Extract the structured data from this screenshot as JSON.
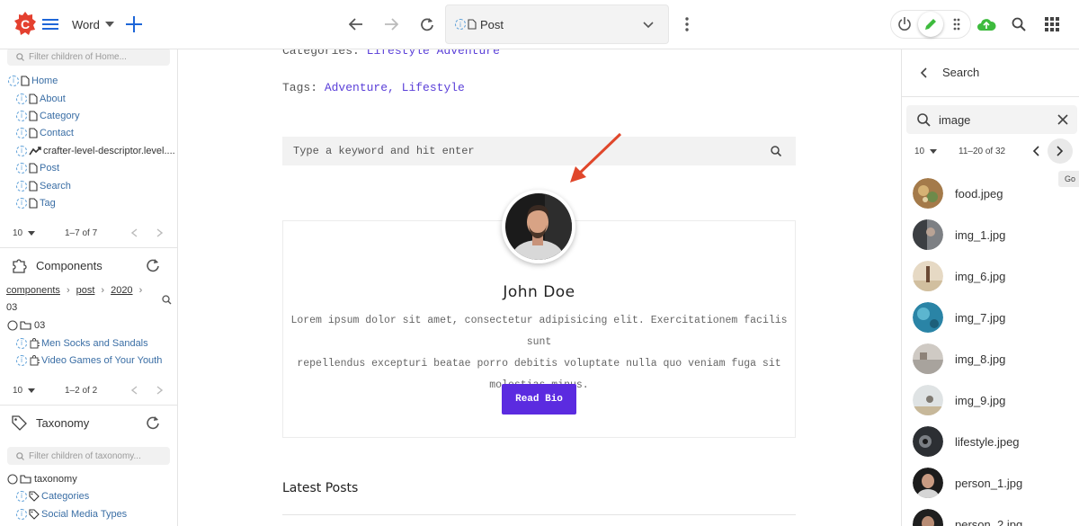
{
  "topbar": {
    "site_name": "Word",
    "url_value": "Post",
    "tooltip": "Go"
  },
  "left": {
    "pages_filter_placeholder": "Filter children of Home...",
    "pages": [
      {
        "label": "Home",
        "icon": "page-icon"
      },
      {
        "label": "About",
        "icon": "page-icon"
      },
      {
        "label": "Category",
        "icon": "page-icon"
      },
      {
        "label": "Contact",
        "icon": "page-icon"
      },
      {
        "label": "crafter-level-descriptor.level....",
        "icon": "level-descriptor-icon"
      },
      {
        "label": "Post",
        "icon": "page-icon"
      },
      {
        "label": "Search",
        "icon": "page-icon"
      },
      {
        "label": "Tag",
        "icon": "page-icon"
      }
    ],
    "pages_pager": {
      "per_page": "10",
      "range": "1–7 of 7"
    },
    "components_title": "Components",
    "breadcrumb": [
      "components",
      "post",
      "2020",
      "03"
    ],
    "components_folder": "03",
    "components": [
      {
        "label": "Men Socks and Sandals"
      },
      {
        "label": "Video Games of Your Youth"
      }
    ],
    "components_pager": {
      "per_page": "10",
      "range": "1–2 of 2"
    },
    "taxonomy_title": "Taxonomy",
    "taxonomy_filter_placeholder": "Filter children of taxonomy...",
    "taxonomy_folder": "taxonomy",
    "taxonomy_items": [
      {
        "label": "Categories"
      },
      {
        "label": "Social Media Types"
      }
    ]
  },
  "main": {
    "categories_label": "Categories:",
    "categories_links": "Lifestyle Adventure",
    "tags_label": "Tags:",
    "tags_links": "Adventure, Lifestyle",
    "search_placeholder": "Type a keyword and hit enter",
    "author_name": "John Doe",
    "author_bio_lines": [
      "Lorem ipsum dolor sit amet, consectetur adipisicing elit. Exercitationem facilis sunt",
      "repellendus excepturi beatae porro debitis voluptate nulla quo veniam fuga sit",
      "molestias minus."
    ],
    "read_bio_label": "Read Bio",
    "latest_posts_title": "Latest Posts",
    "accent_color": "#5b2be0",
    "arrow_color": "#e0472b"
  },
  "right": {
    "title": "Search",
    "query": "image",
    "per_page": "10",
    "range": "11–20 of 32",
    "results": [
      {
        "name": "food.jpeg"
      },
      {
        "name": "img_1.jpg"
      },
      {
        "name": "img_6.jpg"
      },
      {
        "name": "img_7.jpg"
      },
      {
        "name": "img_8.jpg"
      },
      {
        "name": "img_9.jpg"
      },
      {
        "name": "lifestyle.jpeg"
      },
      {
        "name": "person_1.jpg"
      },
      {
        "name": "person_2.jpg"
      }
    ]
  }
}
